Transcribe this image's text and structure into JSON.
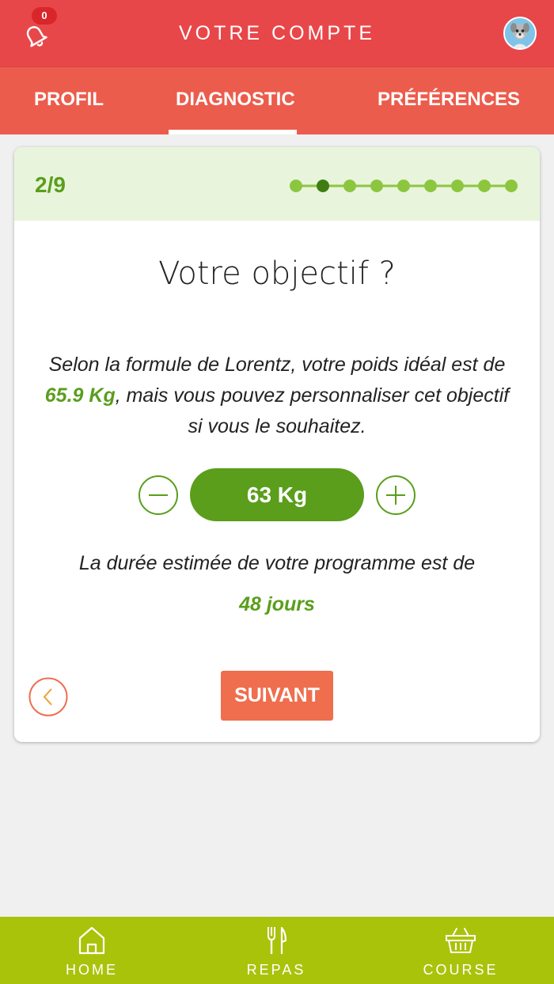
{
  "header": {
    "title": "VOTRE COMPTE",
    "notification_count": "0",
    "bell_icon": "bell-icon",
    "avatar_icon": "user-avatar"
  },
  "tabs": [
    {
      "label": "PROFIL"
    },
    {
      "label": "DIAGNOSTIC",
      "active": true
    },
    {
      "label": "PRÉFÉRENCES"
    }
  ],
  "card": {
    "step": "2/9",
    "total_steps": 9,
    "current_step": 2,
    "question": "Votre objectif ?",
    "desc_part1": "Selon la formule de Lorentz, votre poids idéal est de ",
    "ideal_weight": "65.9 Kg",
    "desc_part2": ", mais vous pouvez personnaliser cet objectif si vous le souhaitez.",
    "weight_value": "63 Kg",
    "duration_label": "La durée estimée de votre programme est de",
    "duration_value": "48 jours",
    "next_label": "SUIVANT"
  },
  "bottom_nav": [
    {
      "label": "HOME",
      "icon": "home-icon"
    },
    {
      "label": "REPAS",
      "icon": "cutlery-icon"
    },
    {
      "label": "COURSE",
      "icon": "basket-icon"
    }
  ],
  "colors": {
    "header": "#e8474a",
    "tabs": "#ec5c4c",
    "green": "#5a9e1c",
    "card_head": "#e9f4dc",
    "next_button": "#ee6e4e",
    "bottom_nav": "#a9c30b"
  }
}
